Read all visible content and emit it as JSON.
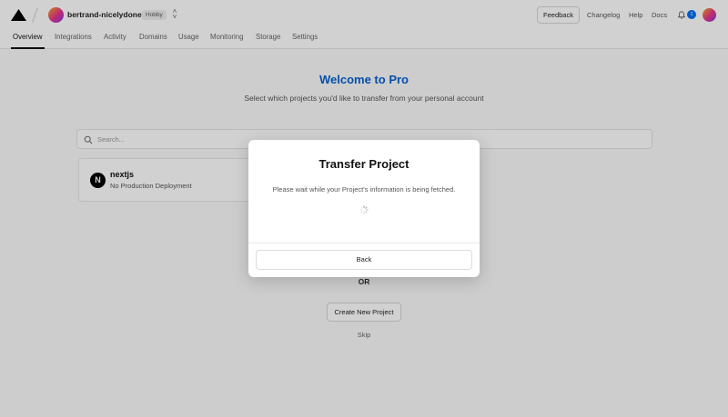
{
  "header": {
    "team_name": "bertrand-nicelydonec",
    "plan_badge": "Hobby",
    "feedback_label": "Feedback",
    "links": [
      "Changelog",
      "Help",
      "Docs"
    ],
    "notification_count": "1"
  },
  "tabs": [
    "Overview",
    "Integrations",
    "Activity",
    "Domains",
    "Usage",
    "Monitoring",
    "Storage",
    "Settings"
  ],
  "active_tab": "Overview",
  "main": {
    "title": "Welcome to Pro",
    "subtitle": "Select which projects you'd like to transfer from your personal account",
    "search_placeholder": "Search...",
    "project": {
      "icon_letter": "N",
      "name": "nextjs",
      "status": "No Production Deployment"
    },
    "or_label": "OR",
    "create_button": "Create New Project",
    "skip_label": "Skip"
  },
  "modal": {
    "title": "Transfer Project",
    "message": "Please wait while your Project's information is being fetched.",
    "back_button": "Back"
  },
  "colors": {
    "accent_blue": "#0761d1",
    "badge_blue": "#0070f3"
  }
}
